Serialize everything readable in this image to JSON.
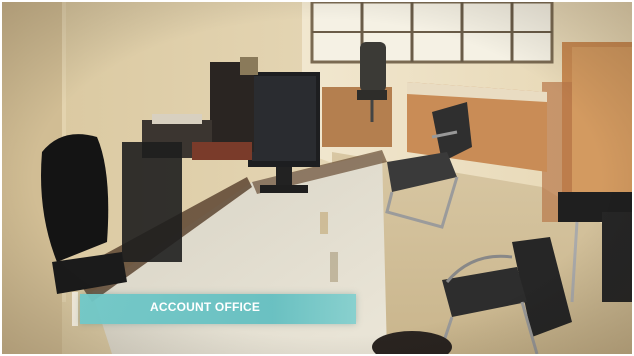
{
  "caption": {
    "label": "ACCOUNT OFFICE",
    "bar_color": "#6cc6c6",
    "text_color": "#ffffff"
  },
  "scene": {
    "description_items": [
      "office-desk",
      "computer-monitor",
      "office-chair",
      "window",
      "cabinet",
      "side-table"
    ]
  }
}
